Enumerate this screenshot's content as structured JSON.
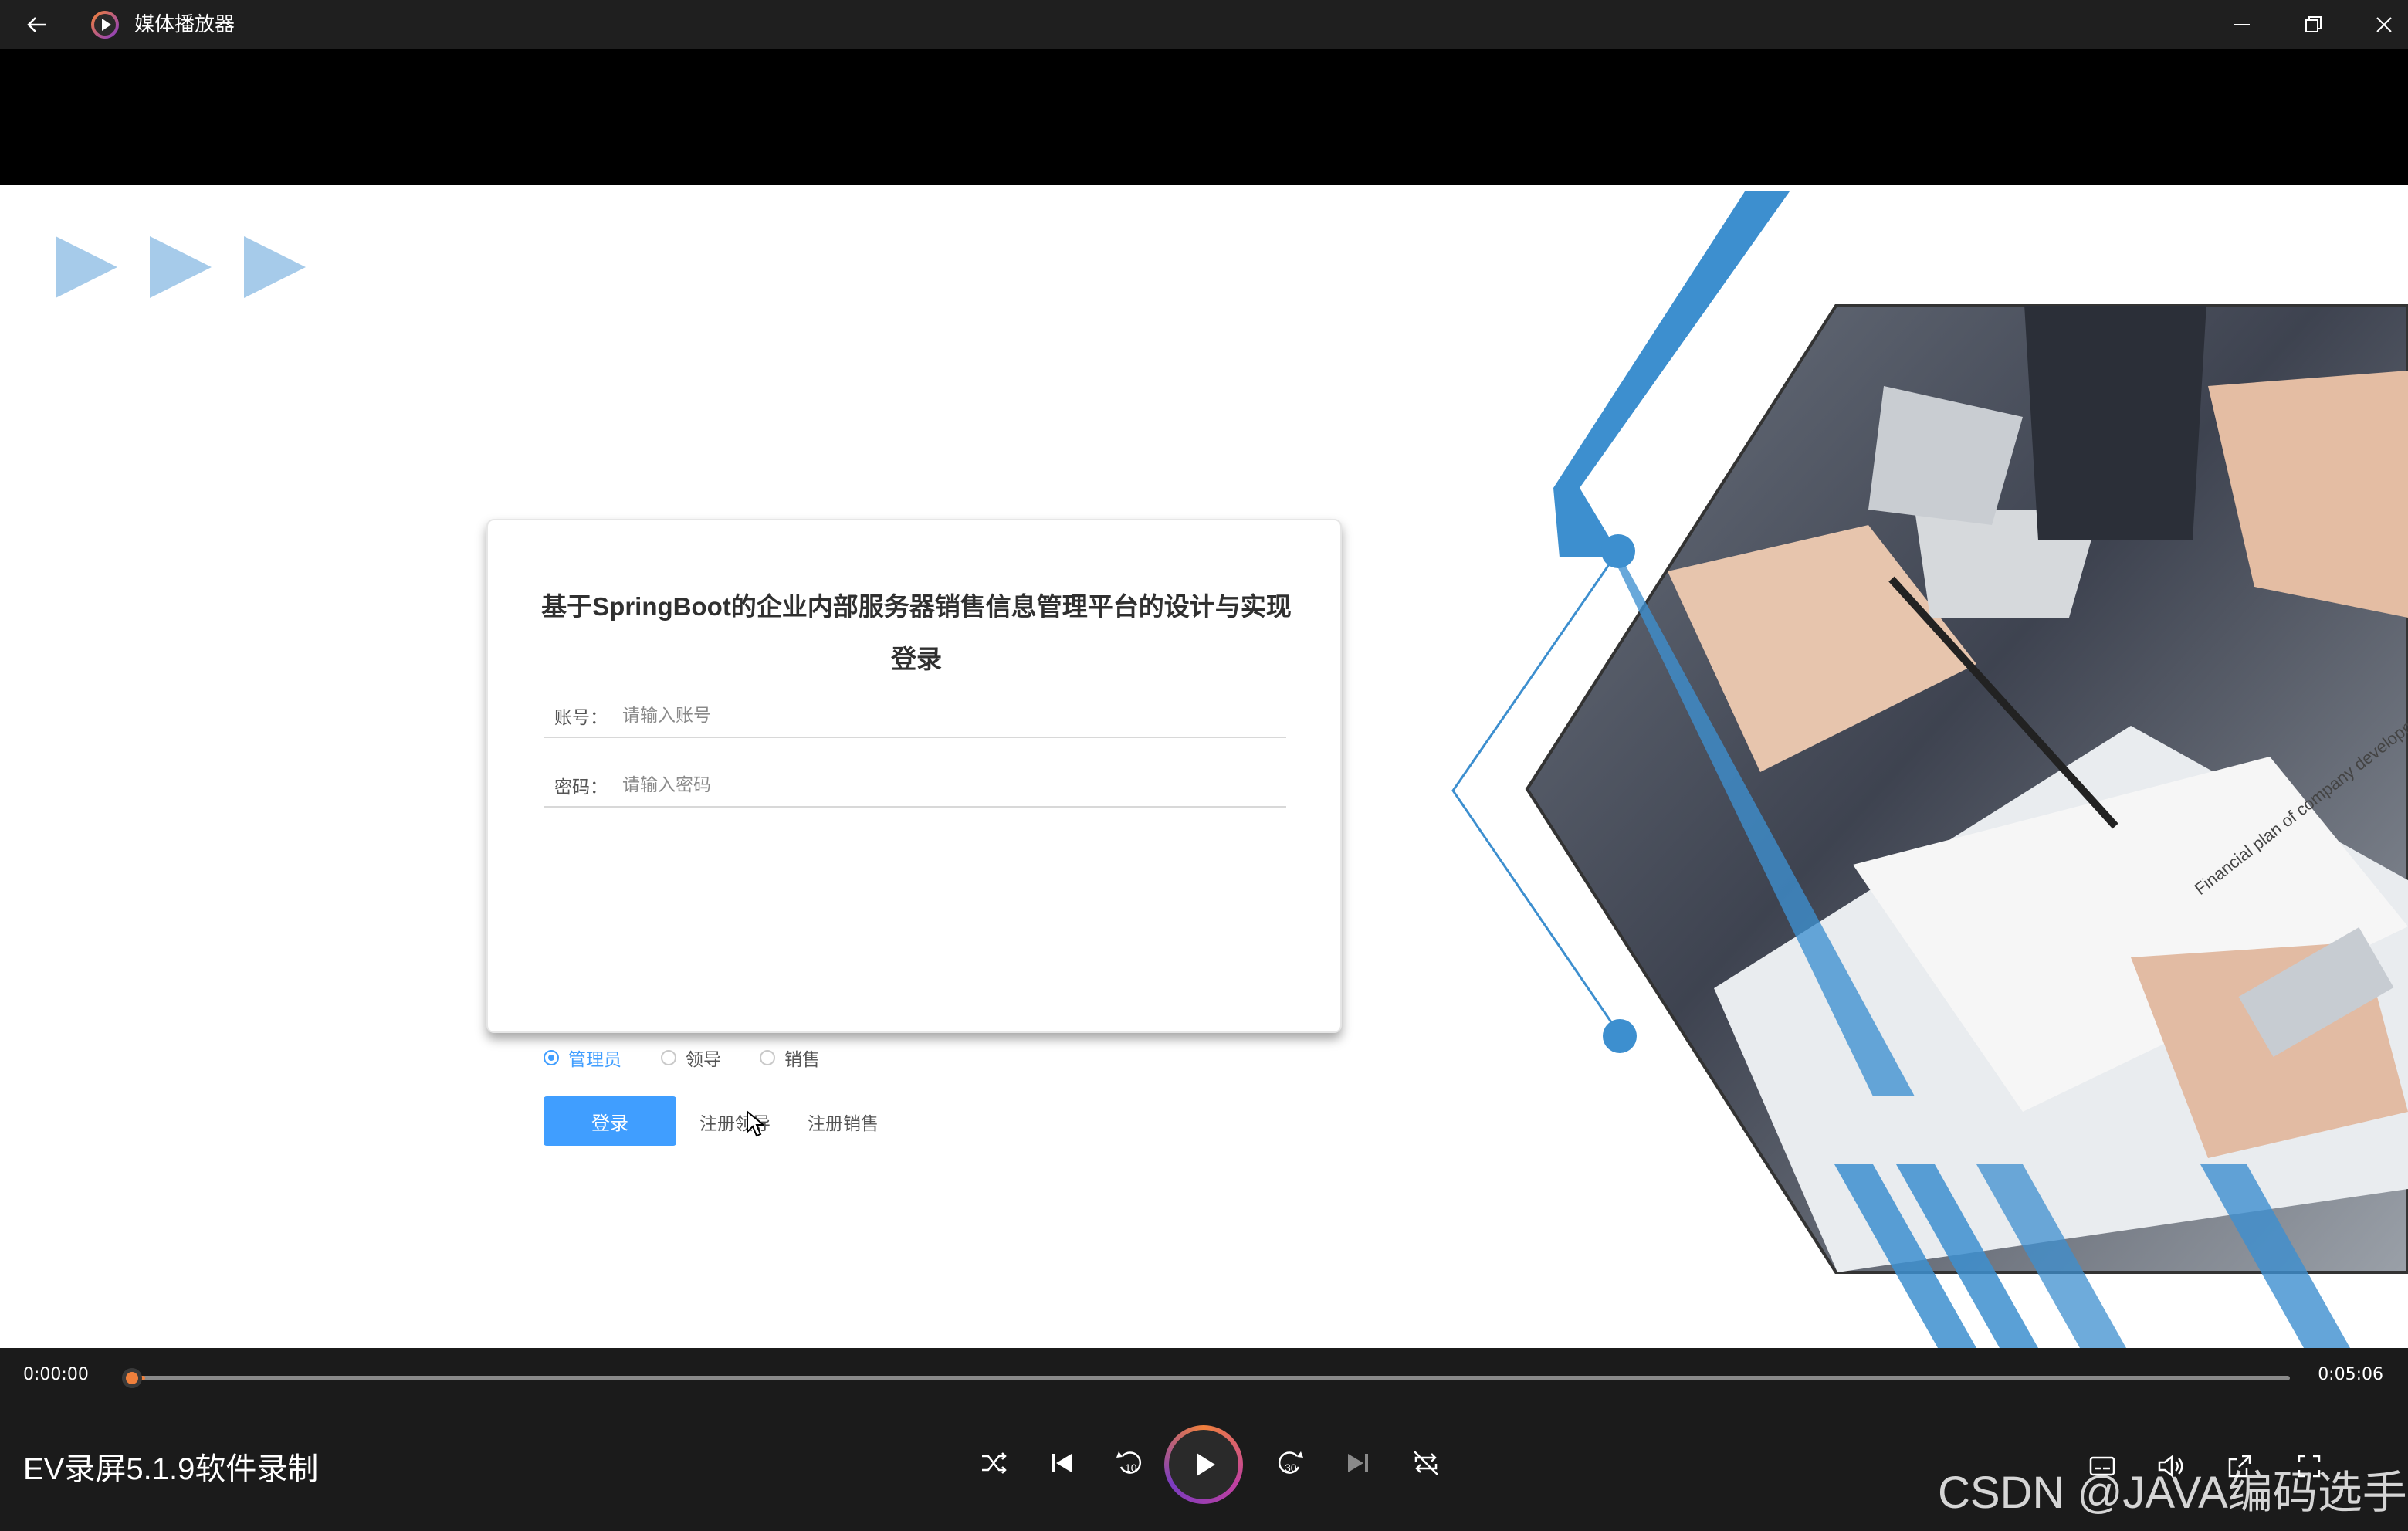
{
  "window": {
    "title": "媒体播放器",
    "icons": [
      "back-arrow-icon",
      "media-player-logo-icon",
      "minimize-icon",
      "restore-icon",
      "close-icon"
    ]
  },
  "login_page": {
    "title": "基于SpringBoot的企业内部服务器销售信息管理平台的设计与实现登录",
    "account": {
      "label": "账号：",
      "placeholder": "请输入账号",
      "value": ""
    },
    "password": {
      "label": "密码：",
      "placeholder": "请输入密码",
      "value": ""
    },
    "roles": [
      {
        "label": "管理员",
        "selected": true
      },
      {
        "label": "领导",
        "selected": false
      },
      {
        "label": "销售",
        "selected": false
      }
    ],
    "login_button": "登录",
    "register_leader": "注册领导",
    "register_sales": "注册销售",
    "image_text": "Financial plan of company development",
    "colors": {
      "accent": "#409eff",
      "hex_blue": "#3d8fcf",
      "arrow_blue": "#a6cbea"
    }
  },
  "player": {
    "current_time": "0:00:00",
    "total_time": "0:05:06",
    "progress": 0.005,
    "media_title": "EV录屏5.1.9软件录制",
    "accent": "#f0803c",
    "controls": [
      "shuffle-icon",
      "previous-icon",
      "rewind-10-icon",
      "play-icon",
      "forward-30-icon",
      "next-icon",
      "repeat-icon"
    ],
    "right_controls": [
      "subtitles-icon",
      "volume-icon",
      "cast-icon",
      "fullscreen-icon"
    ]
  },
  "watermark": "CSDN @JAVA编码选手"
}
